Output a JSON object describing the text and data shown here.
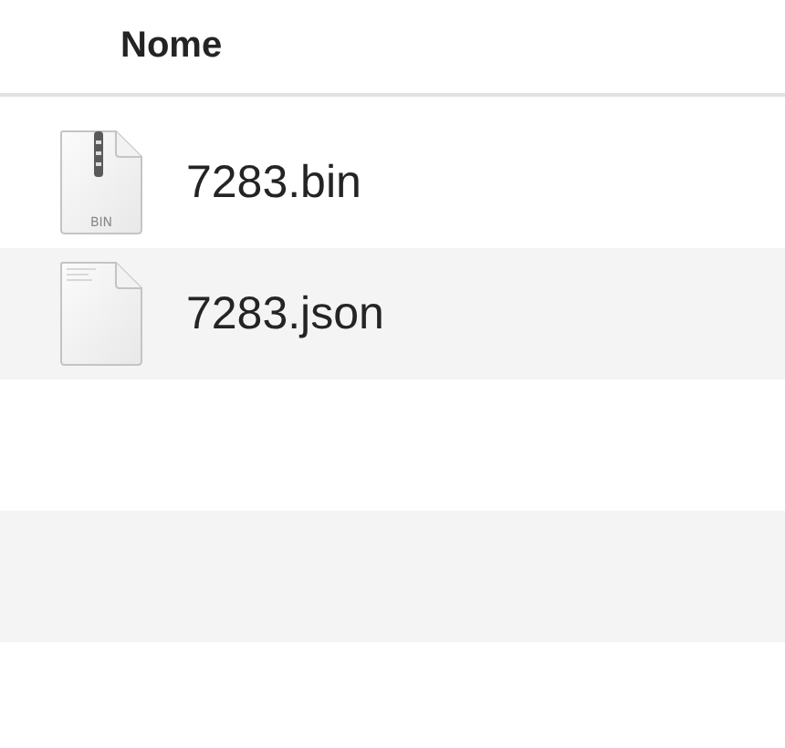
{
  "table": {
    "columns": [
      {
        "label": "Nome"
      }
    ],
    "rows": [
      {
        "name": "7283.bin",
        "kind": "archive",
        "icon_label": "BIN"
      },
      {
        "name": "7283.json",
        "kind": "document"
      }
    ]
  }
}
